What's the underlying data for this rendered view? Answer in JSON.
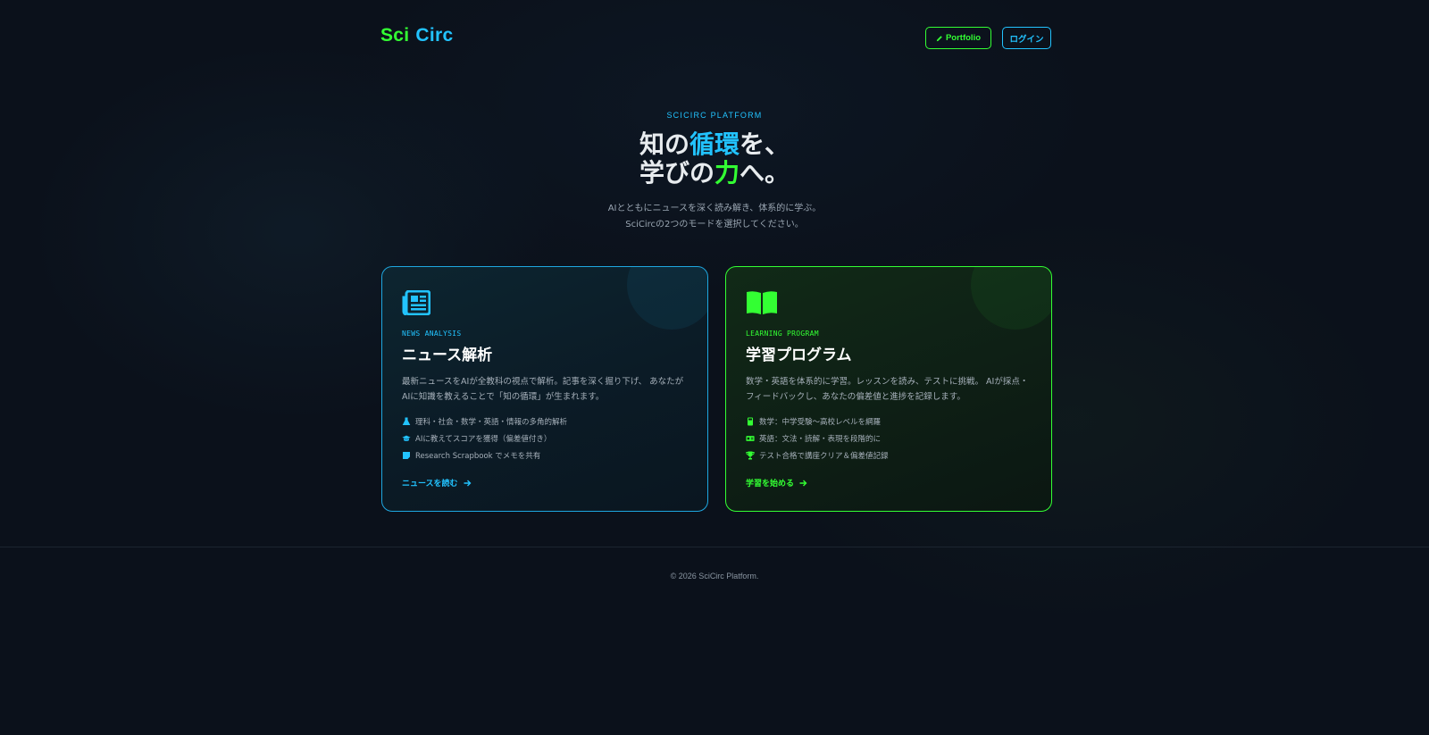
{
  "header": {
    "logo_part1": "Sci",
    "logo_part2": "Circ",
    "portfolio_label": "Portfolio",
    "login_label": "ログイン"
  },
  "hero": {
    "eyebrow": "SCICIRC PLATFORM",
    "headline_line1_a": "知の",
    "headline_line1_b": "循環",
    "headline_line1_c": "を、",
    "headline_line2_a": "学びの",
    "headline_line2_b": "力",
    "headline_line2_c": "へ。",
    "subtext_line1": "AIとともにニュースを深く読み解き、体系的に学ぶ。",
    "subtext_line2": "SciCircの2つのモードを選択してください。"
  },
  "cards": [
    {
      "icon": "newspaper-icon",
      "tag": "NEWS ANALYSIS",
      "title": "ニュース解析",
      "desc_line1": "最新ニュースをAIが全教科の視点で解析。記事を深く掘り下げ、 あなたが",
      "desc_line2": "AIに知識を教えることで「知の循環」が生まれます。",
      "features": [
        {
          "icon": "flask-icon",
          "text": "理科・社会・数学・英語・情報の多角的解析"
        },
        {
          "icon": "graduation-cap-icon",
          "text": "AIに教えてスコアを獲得（偏差値付き）"
        },
        {
          "icon": "sticky-note-icon",
          "text": "Research Scrapbook でメモを共有"
        }
      ],
      "cta": "ニュースを読む"
    },
    {
      "icon": "open-book-icon",
      "tag": "LEARNING PROGRAM",
      "title": "学習プログラム",
      "desc_line1": "数学・英語を体系的に学習。レッスンを読み、テストに挑戦。 AIが採点・",
      "desc_line2": "フィードバックし、あなたの偏差値と進捗を記録します。",
      "features": [
        {
          "icon": "calculator-icon",
          "text": "数学：中学受験〜高校レベルを網羅"
        },
        {
          "icon": "language-icon",
          "text": "英語：文法・読解・表現を段階的に"
        },
        {
          "icon": "trophy-icon",
          "text": "テスト合格で講座クリア＆偏差値記録"
        }
      ],
      "cta": "学習を始める"
    }
  ],
  "footer": {
    "copyright": "© 2026 SciCirc Platform."
  },
  "colors": {
    "background": "#0b111b",
    "accent_green": "#33ff33",
    "accent_cyan": "#22c3ff"
  }
}
